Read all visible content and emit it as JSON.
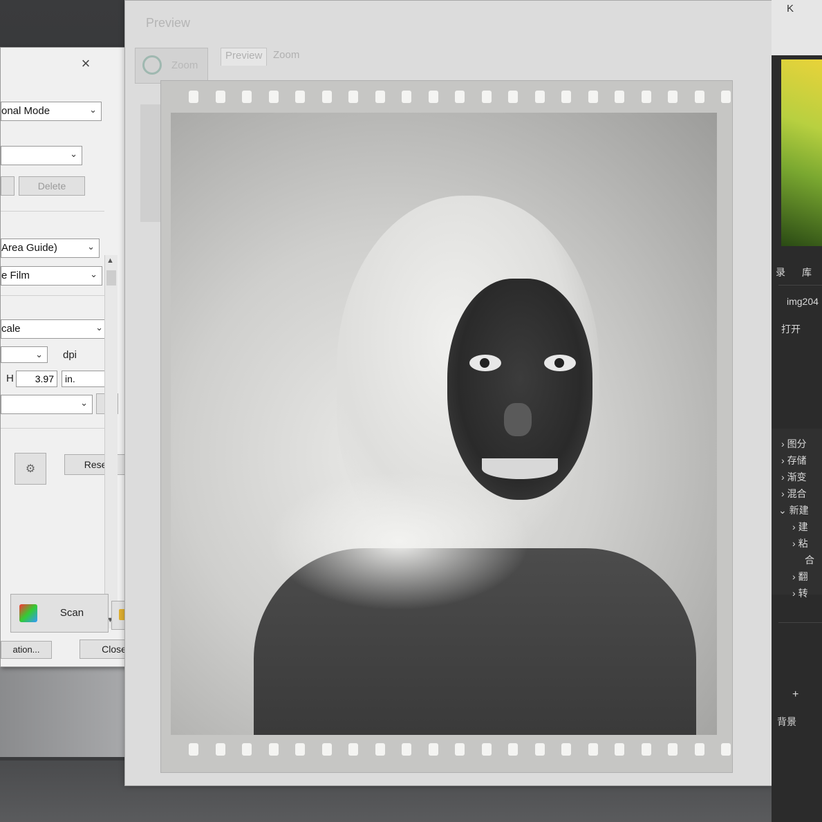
{
  "scan_dialog": {
    "mode_select": "onal Mode",
    "delete_button": "Delete",
    "area_select": "Area Guide)",
    "film_select": "e Film",
    "color_select": "cale",
    "dpi_label": "dpi",
    "height_label": "H",
    "height_value": "3.97",
    "unit_select": "in.",
    "reset_button": "Reset",
    "scan_button": "Scan",
    "config_button": "ation...",
    "close_button": "Close"
  },
  "preview_window": {
    "title": "Preview",
    "zoom_button": "Zoom",
    "tabs": [
      {
        "label": "Preview"
      },
      {
        "label": "Zoom"
      }
    ]
  },
  "right_panel": {
    "mode_letter": "K",
    "tab_1": "录",
    "tab_2": "库",
    "file_name": "img204",
    "open_label": "打开",
    "items": [
      {
        "label": "图分"
      },
      {
        "label": "存储"
      },
      {
        "label": "渐变"
      },
      {
        "label": "混合"
      },
      {
        "label": "新建"
      },
      {
        "label": "建"
      },
      {
        "label": "粘"
      },
      {
        "label": "合"
      },
      {
        "label": "翻"
      },
      {
        "label": "转"
      }
    ],
    "bottom_label": "背景"
  },
  "colors": {
    "film_base": "#c6c6c4",
    "dialog_bg": "#f0f0f0",
    "app_dark": "#2b2b2b"
  }
}
